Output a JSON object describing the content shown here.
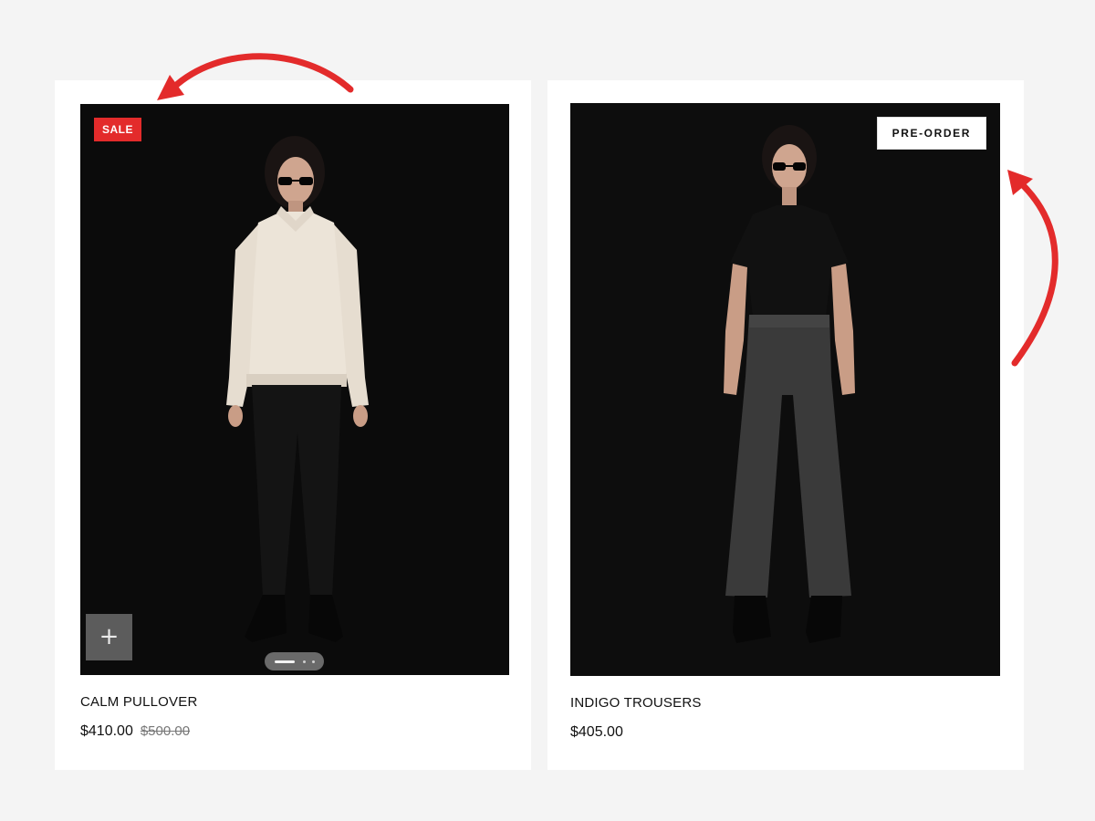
{
  "products": [
    {
      "badge": "SALE",
      "title": "CALM PULLOVER",
      "price": "$410.00",
      "compare_price": "$500.00",
      "quick_add": "+",
      "slides": 3,
      "active_slide": 1
    },
    {
      "badge": "PRE-ORDER",
      "title": "INDIGO TROUSERS",
      "price": "$405.00"
    }
  ],
  "colors": {
    "sale_badge": "#e32b2b",
    "annotation_arrow": "#e32b2b",
    "image_background": "#0b0b0b"
  },
  "icons": {
    "quick_add": "plus-icon",
    "annotation": "curved-arrow-icon"
  }
}
